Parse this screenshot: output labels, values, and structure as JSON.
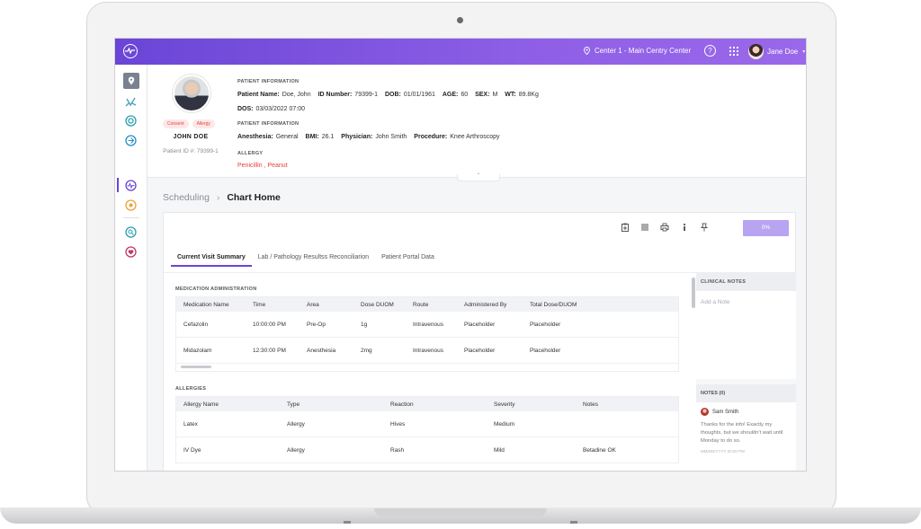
{
  "topbar": {
    "location": "Center 1 - Main Centry Center",
    "help_label": "?",
    "user_name": "Jane Doe",
    "caret": "▾"
  },
  "patient": {
    "tags": [
      "Consent",
      "Allergy"
    ],
    "name": "JOHN DOE",
    "patient_id": "Patient ID #: 79399-1",
    "section1_title": "PATIENT INFORMATION",
    "line1": [
      {
        "label": "Patient Name:",
        "value": "Doe, John"
      },
      {
        "label": "ID Number:",
        "value": "79399-1"
      },
      {
        "label": "DOB:",
        "value": "01/01/1961"
      },
      {
        "label": "AGE:",
        "value": "60"
      },
      {
        "label": "SEX:",
        "value": "M"
      },
      {
        "label": "WT:",
        "value": "89.8Kg"
      }
    ],
    "line2": [
      {
        "label": "DOS:",
        "value": "03/03/2022 07:00"
      }
    ],
    "section2_title": "PATIENT INFORMATION",
    "line3": [
      {
        "label": "Anesthesia:",
        "value": "General"
      },
      {
        "label": "BMI:",
        "value": "26.1"
      },
      {
        "label": "Physician:",
        "value": "John Smith"
      },
      {
        "label": "Procedure:",
        "value": "Knee Arthroscopy"
      }
    ],
    "section3_title": "ALLERGY",
    "allergies": "Penicillin , Peanut",
    "collapse_glyph": "⌃"
  },
  "breadcrumb": {
    "parent": "Scheduling",
    "separator": "›",
    "current": "Chart Home"
  },
  "toolbar": {
    "progress": "0%"
  },
  "tabs": [
    {
      "label": "Current Visit Summary",
      "active": true
    },
    {
      "label": "Lab / Pathology Resultss Reconciliarion",
      "active": false
    },
    {
      "label": "Patient Portal Data",
      "active": false
    }
  ],
  "medication": {
    "title": "MEDICATION ADMINISTRATION",
    "columns": [
      "Medication Name",
      "Time",
      "Area",
      "Dose DUOM",
      "Route",
      "Administered By",
      "Total Dose/DUOM"
    ],
    "rows": [
      [
        "Cefazolin",
        "10:00:00 PM",
        "Pre-Op",
        "1g",
        "Intravenous",
        "Placeholder",
        "Placeholder"
      ],
      [
        "Midazolam",
        "12:30:00 PM",
        "Anesthesia",
        "2mg",
        "Intravenous",
        "Placeholder",
        "Placeholder"
      ]
    ]
  },
  "allergies": {
    "title": "ALLERGIES",
    "columns": [
      "Allergy Name",
      "Type",
      "Reaction",
      "Severity",
      "Notes"
    ],
    "rows": [
      [
        "Latex",
        "Allergy",
        "Hives",
        "Medium",
        ""
      ],
      [
        "IV Dye",
        "Allergy",
        "Rash",
        "Mild",
        "Betadine OK"
      ]
    ]
  },
  "clinical_notes": {
    "title": "CLINICAL NOTES",
    "placeholder": "Add a Note",
    "notes_title": "NOTES (0)",
    "note": {
      "author": "Sam Smith",
      "text": "Thanks for the info! Exactly my thoughts, but we shouldn't wait until Monday to do so.",
      "date": "MM/DD/YYYY 00:00 PM"
    }
  },
  "colors": {
    "accent": "#6a45d6",
    "allergy_red": "#e5413a",
    "progress": "#b8a4f1"
  }
}
